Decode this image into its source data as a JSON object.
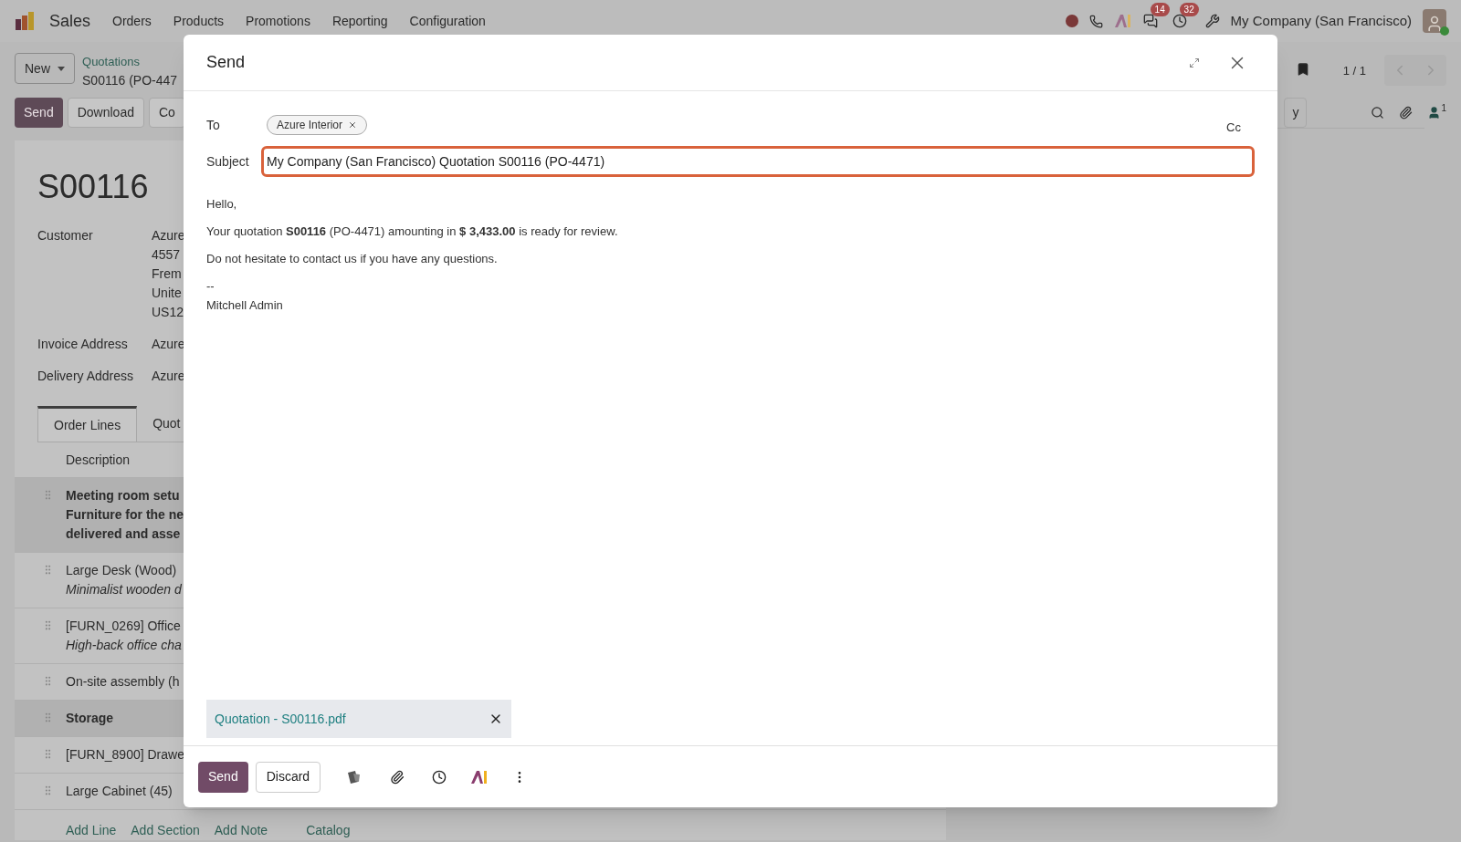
{
  "navbar": {
    "app_name": "Sales",
    "menu": [
      "Orders",
      "Products",
      "Promotions",
      "Reporting",
      "Configuration"
    ],
    "messages_badge": "14",
    "activities_badge": "32",
    "company": "My Company (San Francisco)"
  },
  "control_panel": {
    "new_button": "New",
    "breadcrumb": "Quotations",
    "record": "S00116 (PO-447",
    "pager": "1 / 1",
    "buttons": [
      {
        "label": "Send",
        "primary": true
      },
      {
        "label": "Download",
        "primary": false
      },
      {
        "label": "Co",
        "primary": false
      }
    ],
    "chatter_button": "y",
    "followers": "1"
  },
  "form": {
    "title": "S00116",
    "fields": [
      {
        "label": "Customer",
        "lines": [
          "Azure",
          "4557",
          "Frem",
          "Unite",
          "US12"
        ]
      },
      {
        "label": "Invoice Address",
        "lines": [
          "Azure"
        ]
      },
      {
        "label": "Delivery Address",
        "lines": [
          "Azure"
        ]
      }
    ],
    "tabs": [
      {
        "label": "Order Lines",
        "selected": true
      },
      {
        "label": "Quot",
        "selected": false
      }
    ],
    "column": "Description",
    "lines": [
      {
        "kind": "section",
        "lines": [
          "Meeting room setu",
          "Furniture for the ne",
          "delivered and asse"
        ]
      },
      {
        "kind": "product",
        "lines": [
          "Large Desk (Wood)",
          "Minimalist wooden d"
        ]
      },
      {
        "kind": "product",
        "lines": [
          "[FURN_0269] Office",
          "High-back office cha"
        ]
      },
      {
        "kind": "product",
        "lines": [
          "On-site assembly (h"
        ]
      },
      {
        "kind": "section",
        "lines": [
          "Storage"
        ]
      },
      {
        "kind": "product",
        "lines": [
          "[FURN_8900] Drawe"
        ]
      },
      {
        "kind": "product",
        "lines": [
          "Large Cabinet (45)"
        ]
      }
    ],
    "add_links": [
      "Add Line",
      "Add Section",
      "Add Note",
      "Catalog"
    ]
  },
  "dialog": {
    "title": "Send",
    "to_label": "To",
    "recipients": [
      "Azure Interior"
    ],
    "cc": "Cc",
    "subject_label": "Subject",
    "subject": "My Company (San Francisco) Quotation S00116 (PO-4471)",
    "body": [
      {
        "kind": "para",
        "text": "Hello,"
      },
      {
        "kind": "para",
        "text": "Your quotation **S00116** (PO-4471) amounting in **$ 3,433.00** is ready for review."
      },
      {
        "kind": "para",
        "text": "Do not hesitate to contact us if you have any questions."
      },
      {
        "kind": "line",
        "text": "--"
      },
      {
        "kind": "line",
        "text": "Mitchell Admin"
      }
    ],
    "attachments": [
      "Quotation - S00116.pdf"
    ],
    "send": "Send",
    "discard": "Discard"
  }
}
